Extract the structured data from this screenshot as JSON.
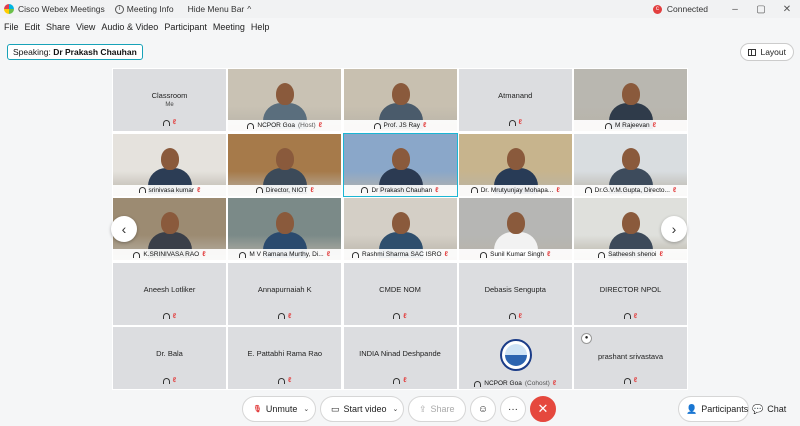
{
  "titlebar": {
    "app_name": "Cisco Webex Meetings",
    "meeting_info": "Meeting Info",
    "hide_menu": "Hide Menu Bar",
    "status": "Connected"
  },
  "menu": [
    "File",
    "Edit",
    "Share",
    "View",
    "Audio & Video",
    "Participant",
    "Meeting",
    "Help"
  ],
  "speaking": {
    "prefix": "Speaking:",
    "name": "Dr Prakash Chauhan"
  },
  "layout_label": "Layout",
  "tiles": [
    {
      "name": "Classroom",
      "sub": "Me",
      "video": false
    },
    {
      "name": "NCPOR Goa",
      "suffix": "(Host)",
      "video": true
    },
    {
      "name": "Prof. JS Ray",
      "video": true
    },
    {
      "name": "Atmanand",
      "video": false
    },
    {
      "name": "M Rajeevan",
      "video": true
    },
    {
      "name": "srinivasa kumar",
      "video": true
    },
    {
      "name": "Director, NIOT",
      "video": true
    },
    {
      "name": "Dr Prakash Chauhan",
      "video": true,
      "active": true
    },
    {
      "name": "Dr. Mrutyunjay Mohapa...",
      "video": true
    },
    {
      "name": "Dr.G.V.M.Gupta, Directo...",
      "video": true
    },
    {
      "name": "K.SRINIVASA RAO",
      "video": true
    },
    {
      "name": "M V Ramana Murthy, Di...",
      "video": true
    },
    {
      "name": "Rashmi Sharma SAC ISRO",
      "video": true
    },
    {
      "name": "Sunil Kumar Singh",
      "video": true
    },
    {
      "name": "Satheesh shenoi",
      "video": true
    },
    {
      "name": "Aneesh Lotliker",
      "video": false
    },
    {
      "name": "Annapurnaiah K",
      "video": false
    },
    {
      "name": "CMDE NOM",
      "video": false
    },
    {
      "name": "Debasis Sengupta",
      "video": false
    },
    {
      "name": "DIRECTOR NPOL",
      "video": false
    },
    {
      "name": "Dr. Bala",
      "video": false
    },
    {
      "name": "E. Pattabhi Rama Rao",
      "video": false
    },
    {
      "name": "INDIA Ninad Deshpande",
      "video": false
    },
    {
      "name": "NCPOR Goa",
      "suffix": "(Cohost)",
      "video": false,
      "logo": true
    },
    {
      "name": "prashant srivastava",
      "video": false
    }
  ],
  "toolbar": {
    "unmute": "Unmute",
    "start_video": "Start video",
    "share": "Share",
    "participants": "Participants",
    "chat": "Chat"
  },
  "colors": {
    "accent": "#1bb6d4",
    "end_call": "#e5483e",
    "mute": "#e23f3f"
  }
}
